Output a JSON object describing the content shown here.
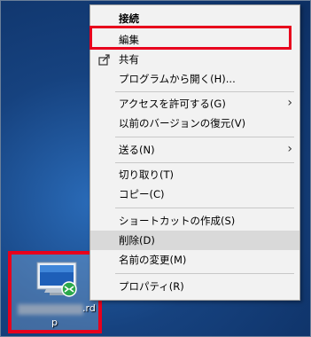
{
  "context_menu": {
    "items": [
      {
        "label": "接続",
        "bold": true
      },
      {
        "label": "編集"
      },
      {
        "label": "共有",
        "icon": "share-icon"
      },
      {
        "label": "プログラムから開く(H)..."
      },
      {
        "label": "アクセスを許可する(G)",
        "submenu": true
      },
      {
        "label": "以前のバージョンの復元(V)"
      },
      {
        "label": "送る(N)",
        "submenu": true
      },
      {
        "label": "切り取り(T)"
      },
      {
        "label": "コピー(C)"
      },
      {
        "label": "ショートカットの作成(S)"
      },
      {
        "label": "削除(D)",
        "hovered": true
      },
      {
        "label": "名前の変更(M)"
      },
      {
        "label": "プロパティ(R)"
      }
    ],
    "submenu_arrow": "›",
    "highlight_color": "#e8001c"
  },
  "desktop_icon": {
    "icon": "remote-desktop-file-icon",
    "name_visible_start": "p",
    "name_visible_ext": ".rd"
  }
}
